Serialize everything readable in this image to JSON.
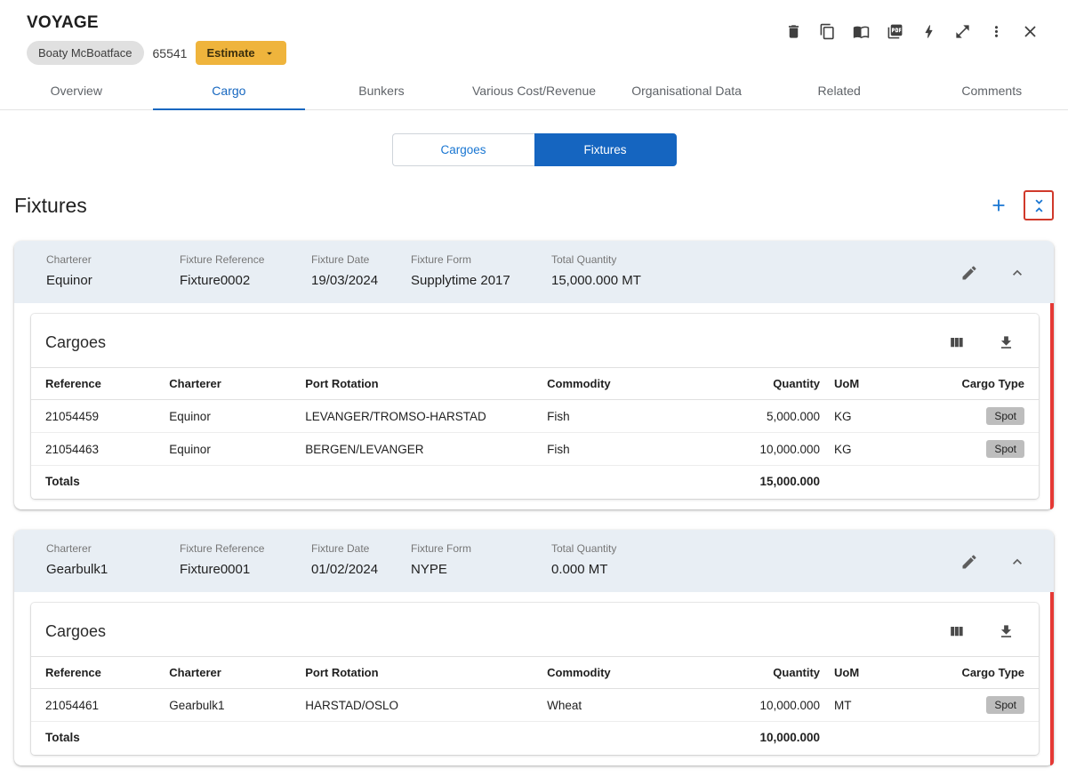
{
  "header": {
    "title": "VOYAGE",
    "vessel_name": "Boaty McBoatface",
    "voyage_number": "65541",
    "estimate_label": "Estimate"
  },
  "header_icons": [
    "delete-icon",
    "copy-icon",
    "book-icon",
    "pdf-icon",
    "bolt-icon",
    "expand-icon",
    "more-vert-icon",
    "close-icon"
  ],
  "tabs": [
    {
      "label": "Overview",
      "active": false
    },
    {
      "label": "Cargo",
      "active": true
    },
    {
      "label": "Bunkers",
      "active": false
    },
    {
      "label": "Various Cost/Revenue",
      "active": false
    },
    {
      "label": "Organisational Data",
      "active": false
    },
    {
      "label": "Related",
      "active": false
    },
    {
      "label": "Comments",
      "active": false
    }
  ],
  "view_toggle": {
    "cargoes_label": "Cargoes",
    "fixtures_label": "Fixtures",
    "active": "Fixtures"
  },
  "section": {
    "title": "Fixtures",
    "action_icons": [
      "add-icon",
      "collapse-all-icon"
    ]
  },
  "field_labels": {
    "charterer": "Charterer",
    "fixture_reference": "Fixture Reference",
    "fixture_date": "Fixture Date",
    "fixture_form": "Fixture Form",
    "total_quantity": "Total Quantity"
  },
  "table": {
    "title": "Cargoes",
    "action_icons": [
      "columns-icon",
      "download-icon"
    ],
    "headers": {
      "reference": "Reference",
      "charterer": "Charterer",
      "port_rotation": "Port Rotation",
      "commodity": "Commodity",
      "quantity": "Quantity",
      "uom": "UoM",
      "cargo_type": "Cargo Type"
    },
    "totals_label": "Totals"
  },
  "fixtures": [
    {
      "charterer": "Equinor",
      "fixture_reference": "Fixture0002",
      "fixture_date": "19/03/2024",
      "fixture_form": "Supplytime 2017",
      "total_quantity": "15,000.000 MT",
      "rows": [
        {
          "reference": "21054459",
          "charterer": "Equinor",
          "port_rotation": "LEVANGER/TROMSO-HARSTAD",
          "commodity": "Fish",
          "quantity": "5,000.000",
          "uom": "KG",
          "cargo_type": "Spot"
        },
        {
          "reference": "21054463",
          "charterer": "Equinor",
          "port_rotation": "BERGEN/LEVANGER",
          "commodity": "Fish",
          "quantity": "10,000.000",
          "uom": "KG",
          "cargo_type": "Spot"
        }
      ],
      "total": "15,000.000"
    },
    {
      "charterer": "Gearbulk1",
      "fixture_reference": "Fixture0001",
      "fixture_date": "01/02/2024",
      "fixture_form": "NYPE",
      "total_quantity": "0.000 MT",
      "rows": [
        {
          "reference": "21054461",
          "charterer": "Gearbulk1",
          "port_rotation": "HARSTAD/OSLO",
          "commodity": "Wheat",
          "quantity": "10,000.000",
          "uom": "MT",
          "cargo_type": "Spot"
        }
      ],
      "total": "10,000.000"
    }
  ],
  "colors": {
    "accent_blue": "#1565c0",
    "tab_blue": "#1667c0",
    "estimate_yellow": "#efb43c",
    "alert_red": "#e53935",
    "fixture_header_bg": "#e8eef4",
    "chip_gray": "#bdbdbd"
  }
}
